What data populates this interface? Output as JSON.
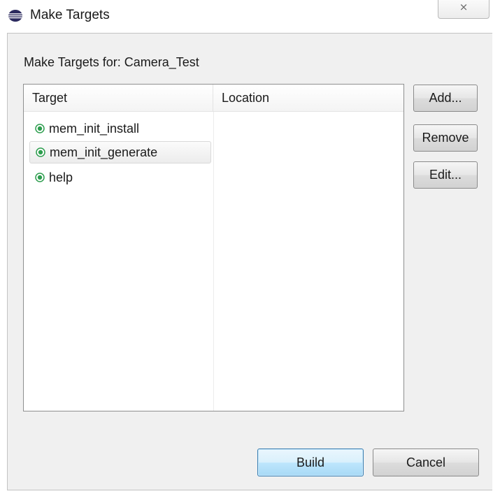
{
  "window": {
    "title": "Make Targets",
    "close_glyph": "⨯"
  },
  "dialog": {
    "header_label": "Make Targets for: Camera_Test",
    "table": {
      "columns": [
        "Target",
        "Location"
      ],
      "rows": [
        {
          "target": "mem_init_install",
          "location": "",
          "icon": "make-target-icon"
        },
        {
          "target": "mem_init_generate",
          "location": "",
          "icon": "make-target-icon",
          "selected": true
        },
        {
          "target": "help",
          "location": "",
          "icon": "make-target-icon"
        }
      ]
    },
    "buttons": {
      "add": "Add...",
      "remove": "Remove",
      "edit": "Edit...",
      "build": "Build",
      "cancel": "Cancel"
    }
  },
  "colors": {
    "target_icon": "#2e9e4f",
    "default_button_border": "#3c7fb1"
  }
}
